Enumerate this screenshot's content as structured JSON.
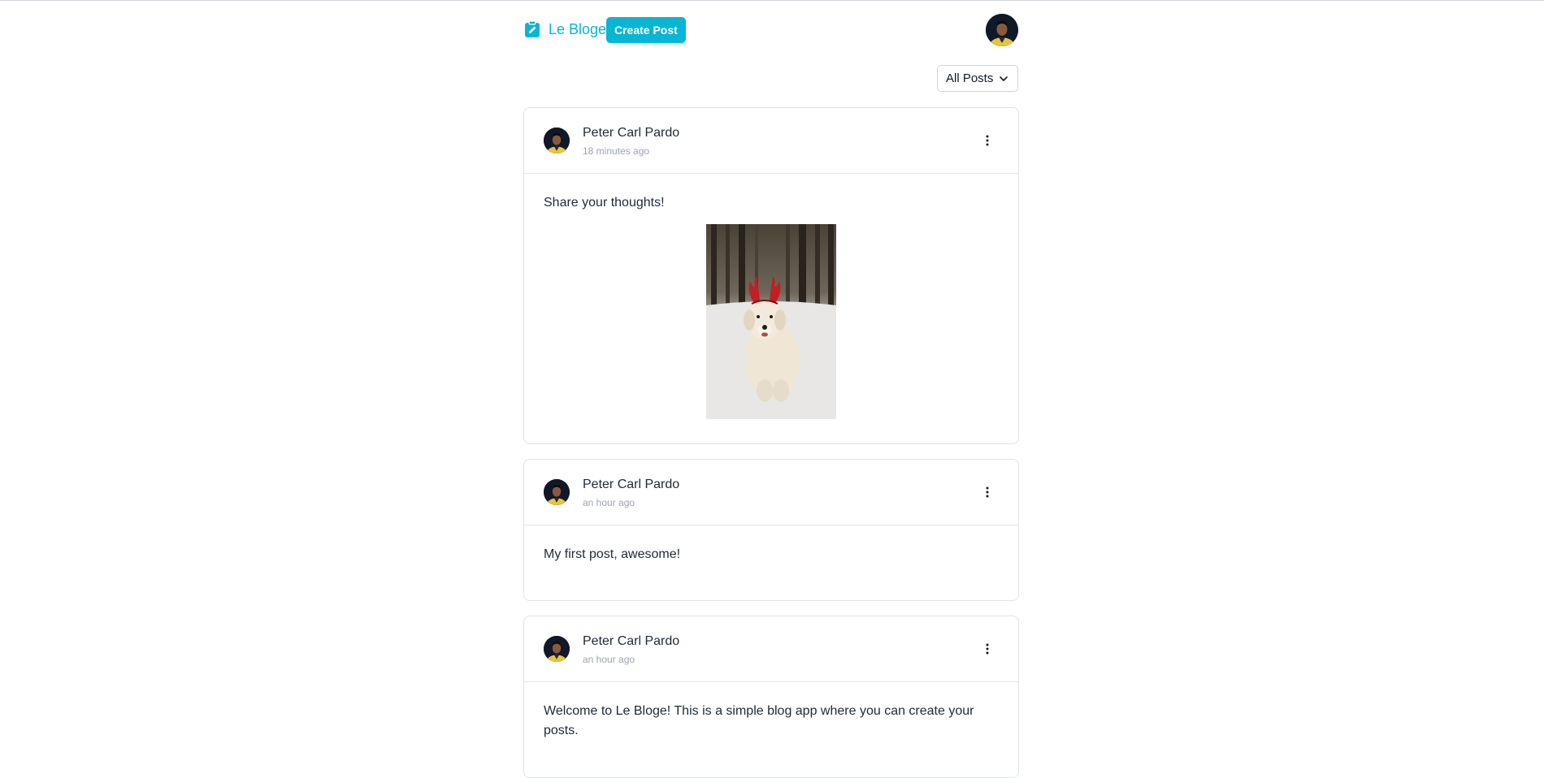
{
  "app": {
    "brand_name": "Le Bloge",
    "brand_color": "#06b6d4",
    "create_post_label": "Create Post",
    "brand_icon": "edit-note-icon",
    "user_avatar": "user-avatar"
  },
  "filter": {
    "selected": "All Posts",
    "icon": "chevron-down-icon"
  },
  "posts": [
    {
      "author": "Peter Carl Pardo",
      "time": "18 minutes ago",
      "content": "Share your thoughts!",
      "has_image": true,
      "image": "dog-with-reindeer-antlers-in-snow"
    },
    {
      "author": "Peter Carl Pardo",
      "time": "an hour ago",
      "content": "My first post, awesome!",
      "has_image": false
    },
    {
      "author": "Peter Carl Pardo",
      "time": "an hour ago",
      "content": "Welcome to Le Bloge! This is a simple blog app where you can create your posts.",
      "has_image": false
    }
  ]
}
